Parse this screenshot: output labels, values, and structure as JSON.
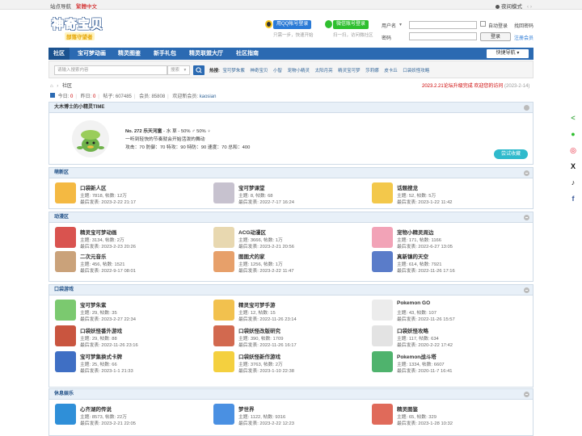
{
  "topbar": {
    "nav_label": "站点导航",
    "lang_label": "繁體中文",
    "night_label": "夜间模式",
    "arrows": "‹ ›"
  },
  "logo": {
    "main": "神奇宝贝",
    "sub": "部落守望者"
  },
  "quick_login": {
    "qq": {
      "button": "用QQ帐号登录",
      "sub": "只需一步，快速开始"
    },
    "wechat": {
      "button": "微信账号登录",
      "sub": "扫一扫，访问微社区"
    }
  },
  "login": {
    "user_label": "用户名",
    "user_caret": "▾",
    "auto_label": "自动登录",
    "find_pwd": "找回密码",
    "pwd_label": "密码",
    "submit": "登录",
    "register": "注册会员"
  },
  "nav": {
    "items": [
      "社区",
      "宝可梦动画",
      "精灵图鉴",
      "新手礼包",
      "精灵联盟大厅",
      "社区指南"
    ],
    "quick": "快捷导航 ▾"
  },
  "search": {
    "placeholder": "请输入搜索内容",
    "select": "搜索",
    "select_caret": "▾",
    "hot_label": "热搜:",
    "hot": [
      "宝可梦朱紫",
      "神奇宝贝",
      "小智",
      "宠物小精灵",
      "太阳月亮",
      "精灵宝可梦",
      "莎莉娜",
      "皮卡丘",
      "口袋妖怪攻略"
    ]
  },
  "breadcrumb": {
    "home_icon": "⌂",
    "sep1": "›",
    "forum": "社区"
  },
  "notice": {
    "text": "2023.2.21论坛升级完成 欢迎您的访问",
    "date": "(2023-2-14)"
  },
  "stats": {
    "today_label": "今日:",
    "today": "0",
    "yesterday_label": "昨日:",
    "yesterday": "0",
    "posts_label": "帖子:",
    "posts": "607485",
    "members_label": "会员:",
    "members": "85808",
    "newest_label": "欢迎新会员:",
    "newest": "kaosian"
  },
  "pokemon_card": {
    "title": "大木博士的小精灵TIME",
    "line1_a": "No. 272 乐天河童",
    "line1_b": " - 水 草 - 50% ♂ 50% ♀",
    "line2": "一听到轻快的节奏就会开始活泼的舞动",
    "line3": "攻击：70 防御：70 特攻：90 特防：90 速度：70 总和：400",
    "share": "尝试收藏"
  },
  "sections": [
    {
      "title": "萌新区",
      "forums": [
        {
          "name": "口袋新人区",
          "stats": "主题: 7818, 帖数: 12万",
          "last": "最后发表: 2023-2-22 21:17",
          "icon_color": "#f4b942"
        },
        {
          "name": "宝可梦课堂",
          "stats": "主题: 8, 帖数: 68",
          "last": "最后发表: 2022-7-17 16:24",
          "icon_color": "#c7c2cf"
        },
        {
          "name": "话题搜龙",
          "stats": "主题: 52, 帖数: 5万",
          "last": "最后发表: 2023-1-22 11:42",
          "icon_color": "#f3c84b"
        }
      ]
    },
    {
      "title": "动漫区",
      "forums": [
        {
          "name": "精灵宝可梦动画",
          "stats": "主题: 3134, 帖数: 2万",
          "last": "最后发表: 2023-2-23 20:26",
          "icon_color": "#d9534f"
        },
        {
          "name": "ACG动漫区",
          "stats": "主题: 3666, 帖数: 1万",
          "last": "最后发表: 2023-2-21 20:56",
          "icon_color": "#e8d8b0"
        },
        {
          "name": "宠物小精灵周边",
          "stats": "主题: 171, 帖数: 1166",
          "last": "最后发表: 2022-6-27 13:05",
          "icon_color": "#f2a3b7"
        },
        {
          "name": "二次元音乐",
          "stats": "主题: 456, 帖数: 1521",
          "last": "最后发表: 2022-9-17 08:01",
          "icon_color": "#caa27a"
        },
        {
          "name": "图图犬的家",
          "stats": "主题: 1256, 帖数: 1万",
          "last": "最后发表: 2023-2-22 11:47",
          "icon_color": "#e7a06a"
        },
        {
          "name": "真新镇的天空",
          "stats": "主题: 614, 帖数: 7921",
          "last": "最后发表: 2022-11-26 17:16",
          "icon_color": "#5a7cc9"
        }
      ]
    },
    {
      "title": "口袋游戏",
      "forums": [
        {
          "name": "宝可梦朱紫",
          "stats": "主题: 29, 帖数: 35",
          "last": "最后发表: 2023-2-27 22:34",
          "icon_color": "#7bc96f"
        },
        {
          "name": "精灵宝可梦手游",
          "stats": "主题: 12, 帖数: 15",
          "last": "最后发表: 2022-11-26 23:14",
          "icon_color": "#f2c14e"
        },
        {
          "name": "Pokemon GO",
          "stats": "主题: 43, 帖数: 107",
          "last": "最后发表: 2022-11-26 15:57",
          "icon_color": "#ececec"
        },
        {
          "name": "口袋妖怪番外游戏",
          "stats": "主题: 29, 帖数: 88",
          "last": "最后发表: 2022-11-26 23:16",
          "icon_color": "#c9553f"
        },
        {
          "name": "口袋妖怪改版研究",
          "stats": "主题: 390, 帖数: 1709",
          "last": "最后发表: 2022-11-26 16:17",
          "icon_color": "#d2694f"
        },
        {
          "name": "口袋妖怪攻略",
          "stats": "主题: 117, 帖数: 634",
          "last": "最后发表: 2020-2-22 17:42",
          "icon_color": "#e3e3e3"
        },
        {
          "name": "宝可梦集换式卡牌",
          "stats": "主题: 25, 帖数: 66",
          "last": "最后发表: 2023-1-1 21:33",
          "icon_color": "#3f6fc4"
        },
        {
          "name": "口袋妖怪新作游戏",
          "stats": "主题: 3763, 帖数: 2万",
          "last": "最后发表: 2023-1-10 22:38",
          "icon_color": "#f4d03f"
        },
        {
          "name": "Pokemon战斗塔",
          "stats": "主题: 1334, 帖数: 6607",
          "last": "最后发表: 2020-11-7 16:41",
          "icon_color": "#4fb36d"
        }
      ]
    },
    {
      "title": "休息娱乐",
      "forums": [
        {
          "name": "心齐湖的传说",
          "stats": "主题: 8573, 帖数: 22万",
          "last": "最后发表: 2023-2-21 22:05",
          "icon_color": "#2f8fd8"
        },
        {
          "name": "梦世界",
          "stats": "主题: 1122, 帖数: 9316",
          "last": "最后发表: 2023-2-22 12:23",
          "icon_color": "#4a90e2"
        },
        {
          "name": "精灵图鉴",
          "stats": "主题: 65, 帖数: 329",
          "last": "最后发表: 2023-1-28 10:32",
          "icon_color": "#e06a5a"
        }
      ]
    }
  ],
  "social": [
    {
      "name": "share-icon",
      "glyph": "<",
      "color": "#4caf50"
    },
    {
      "name": "wechat-icon",
      "glyph": "●",
      "color": "#2fbf2f"
    },
    {
      "name": "weibo-icon",
      "glyph": "◎",
      "color": "#e6162d"
    },
    {
      "name": "x-icon",
      "glyph": "X",
      "color": "#111111"
    },
    {
      "name": "tiktok-icon",
      "glyph": "♪",
      "color": "#111111"
    },
    {
      "name": "facebook-icon",
      "glyph": "f",
      "color": "#3b5998"
    }
  ],
  "colors": {
    "nav": "#2b6ab2",
    "red": "#cc0000",
    "blue": "#336699"
  }
}
